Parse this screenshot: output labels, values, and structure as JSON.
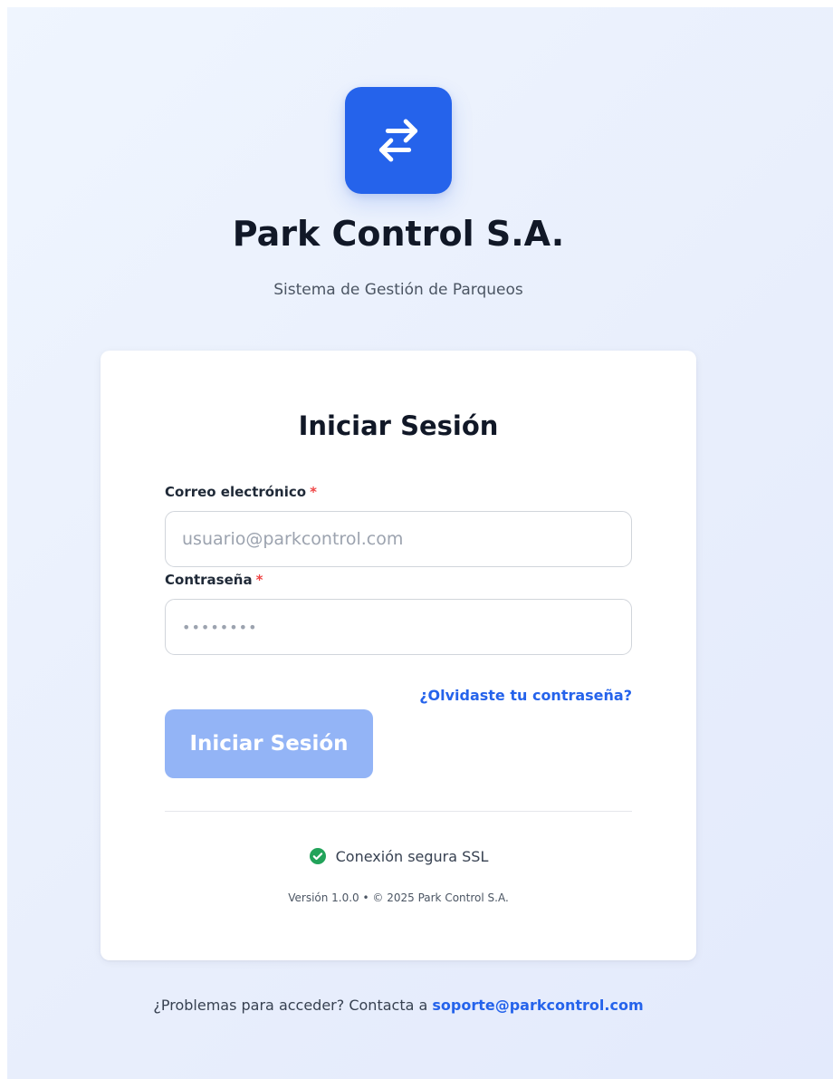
{
  "brand": {
    "logo_icon": "arrows-exchange-icon",
    "title": "Park Control S.A.",
    "subtitle": "Sistema de Gestión de Parqueos",
    "accent_color": "#2563eb"
  },
  "login": {
    "heading": "Iniciar Sesión",
    "email": {
      "label": "Correo electrónico",
      "required_mark": "*",
      "value": "",
      "placeholder": "usuario@parkcontrol.com"
    },
    "password": {
      "label": "Contraseña",
      "required_mark": "*",
      "value": "",
      "placeholder": "••••••••"
    },
    "forgot_link": "¿Olvidaste tu contraseña?",
    "submit_label": "Iniciar Sesión",
    "submit_color": "#93b4f6",
    "security": {
      "icon": "check-circle-icon",
      "text": "Conexión segura SSL",
      "color": "#22a35a"
    },
    "version": "Versión 1.0.0 • © 2025 Park Control S.A."
  },
  "support": {
    "text": "¿Problemas para acceder? Contacta a",
    "email": "soporte@parkcontrol.com"
  }
}
